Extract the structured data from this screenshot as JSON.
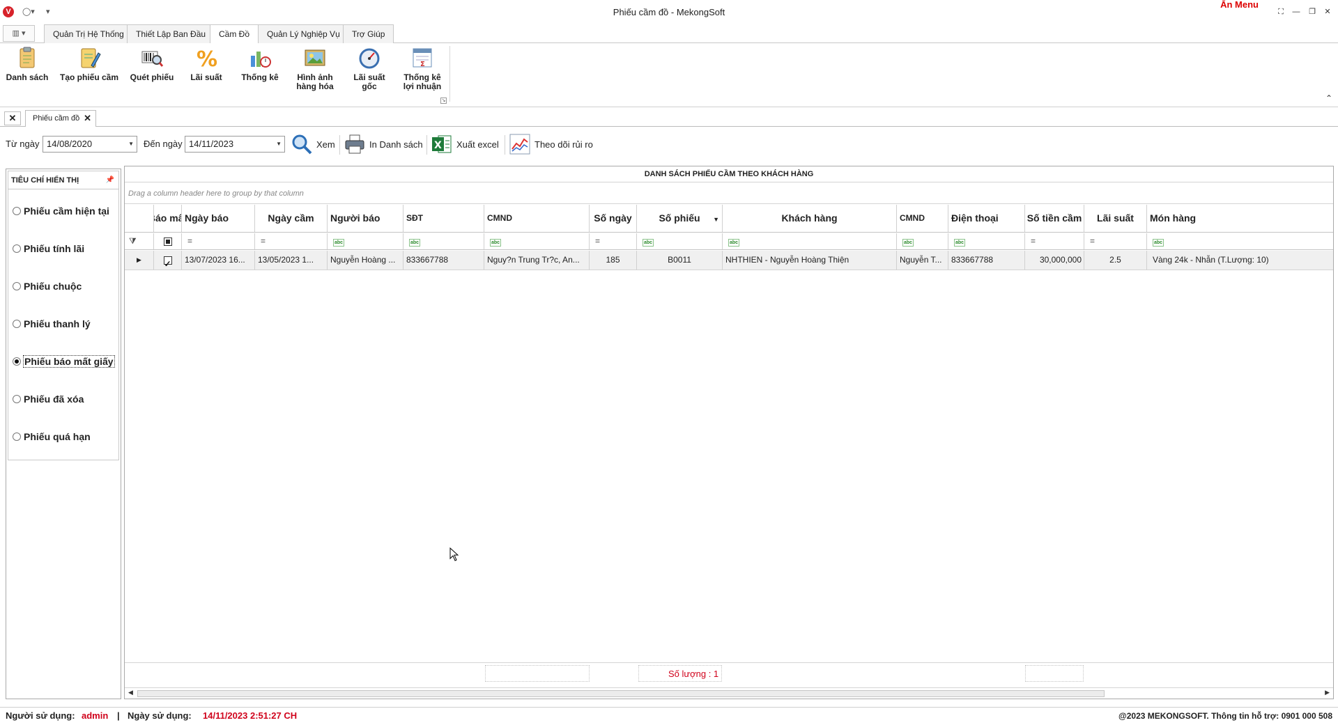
{
  "window": {
    "title": "Phiếu cầm đồ - MekongSoft",
    "hide_menu": "Ẩn Menu"
  },
  "ribbon": {
    "tabs": [
      "Quản Trị Hệ Thống",
      "Thiết Lập Ban Đầu",
      "Cầm Đồ",
      "Quản Lý Nghiệp Vụ",
      "Trợ Giúp"
    ],
    "active_tab": "Cầm Đồ",
    "buttons": [
      {
        "label": "Danh sách",
        "icon": "clipboard-icon"
      },
      {
        "label": "Tạo phiếu cầm",
        "icon": "edit-document-icon"
      },
      {
        "label": "Quét phiếu",
        "icon": "barcode-scan-icon"
      },
      {
        "label": "Lãi suất",
        "icon": "percent-icon"
      },
      {
        "label": "Thống kê",
        "icon": "bar-chart-icon"
      },
      {
        "label": "Hình ảnh hàng hóa",
        "icon": "image-icon"
      },
      {
        "label": "Lãi suất gốc",
        "icon": "gauge-icon"
      },
      {
        "label": "Thống kê lợi nhuận",
        "icon": "profit-report-icon"
      }
    ]
  },
  "doc_tabs": {
    "close_all": "✕",
    "active": "Phiếu cầm đồ"
  },
  "filter": {
    "from_label": "Từ ngày",
    "from_value": "14/08/2020",
    "to_label": "Đến ngày",
    "to_value": "14/11/2023",
    "view_label": "Xem",
    "print_label": "In Danh sách",
    "excel_label": "Xuất excel",
    "risk_label": "Theo dõi rủi ro"
  },
  "left_panel": {
    "title": "TIÊU CHÍ HIỂN THỊ",
    "pin": "ᵖ",
    "options": [
      {
        "label": "Phiếu cầm hiện tại",
        "selected": false
      },
      {
        "label": "Phiếu tính lãi",
        "selected": false
      },
      {
        "label": "Phiếu chuộc",
        "selected": false
      },
      {
        "label": "Phiếu thanh lý",
        "selected": false
      },
      {
        "label": "Phiếu báo mất giấy",
        "selected": true
      },
      {
        "label": "Phiếu đã xóa",
        "selected": false
      },
      {
        "label": "Phiếu quá hạn",
        "selected": false
      }
    ]
  },
  "grid": {
    "title": "DANH SÁCH PHIẾU CẦM THEO KHÁCH HÀNG",
    "group_hint": "Drag a column header here to group by that column",
    "columns": [
      "Báo mất",
      "Ngày báo",
      "Ngày cầm",
      "Người báo",
      "SĐT",
      "CMND",
      "Số ngày",
      "Số phiếu",
      "Khách hàng",
      "CMND",
      "Điện thoại",
      "Số tiền cầm",
      "Lãi suất",
      "Món hàng"
    ],
    "filter_ops": [
      "=",
      "=",
      "abc",
      "abc",
      "abc",
      "=",
      "abc",
      "abc",
      "abc",
      "abc",
      "=",
      "=",
      "abc"
    ],
    "rows": [
      {
        "bao_mat": true,
        "ngay_bao": "13/07/2023 16...",
        "ngay_cam": "13/05/2023 1...",
        "nguoi_bao": "Nguyễn Hoàng ...",
        "sdt": "833667788",
        "cmnd": "Nguy?n Trung Tr?c, An...",
        "so_ngay": "185",
        "so_phieu": "B0011",
        "khach_hang": "NHTHIEN - Nguyễn Hoàng Thiện",
        "cmnd2": "Nguyễn T...",
        "dien_thoai": "833667788",
        "so_tien_cam": "30,000,000",
        "lai_suat": "2.5",
        "mon_hang": "Vàng 24k - Nhẫn (T.Lượng: 10)"
      }
    ],
    "count_text": "Số lượng : 1"
  },
  "status": {
    "user_label": "Người sử dụng:",
    "user_value": "admin",
    "sep": "|",
    "date_label": "Ngày sử dụng:",
    "date_value": "14/11/2023 2:51:27 CH",
    "copyright": "@2023 MEKONGSOFT. Thông tin hỗ trợ: 0901 000 508"
  },
  "colors": {
    "accent_red": "#d0021b",
    "excel_green": "#1e7b3a"
  }
}
